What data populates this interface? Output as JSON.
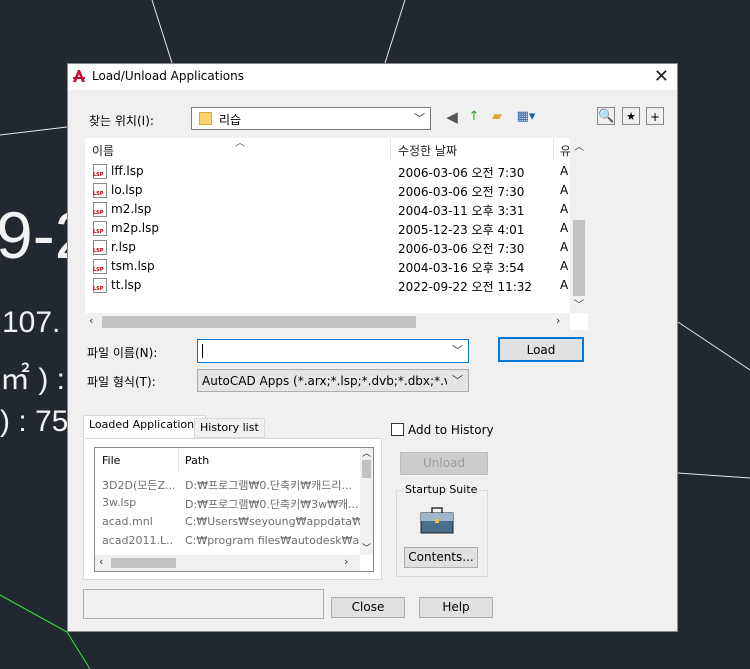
{
  "background": {
    "text1": "9-2",
    "text2": "107.",
    "text3": "㎡ )  :",
    "text4": ") : 75"
  },
  "dialog": {
    "title": "Load/Unload Applications",
    "look_in_label": "찾는 위치(I):",
    "look_in_value": "리습",
    "columns": {
      "name": "이름",
      "date": "수정한 날짜",
      "type": "유"
    },
    "files": [
      {
        "name": "lff.lsp",
        "date": "2006-03-06 오전 7:30",
        "type": "A"
      },
      {
        "name": "lo.lsp",
        "date": "2006-03-06 오전 7:30",
        "type": "A"
      },
      {
        "name": "m2.lsp",
        "date": "2004-03-11 오후 3:31",
        "type": "A"
      },
      {
        "name": "m2p.lsp",
        "date": "2005-12-23 오후 4:01",
        "type": "A"
      },
      {
        "name": "r.lsp",
        "date": "2006-03-06 오전 7:30",
        "type": "A"
      },
      {
        "name": "tsm.lsp",
        "date": "2004-03-16 오후 3:54",
        "type": "A"
      },
      {
        "name": "tt.lsp",
        "date": "2022-09-22 오전 11:32",
        "type": "A"
      }
    ],
    "file_name_label": "파일 이름(N):",
    "file_name_value": "",
    "file_type_label": "파일 형식(T):",
    "file_type_value": "AutoCAD Apps (*.arx;*.lsp;*.dvb;*.dbx;*.vlx;*.fa",
    "load_button": "Load",
    "tabs": [
      "Loaded Applications",
      "History list"
    ],
    "applist_columns": {
      "file": "File",
      "path": "Path"
    },
    "loaded_apps": [
      {
        "file": "3D2D(모든Z...",
        "path": "D:₩프로그램₩0.단축키₩캐드리..."
      },
      {
        "file": "3w.lsp",
        "path": "D:₩프로그램₩0.단축키₩3w₩캐..."
      },
      {
        "file": "acad.mnl",
        "path": "C:₩Users₩seyoung₩appdata₩ro..."
      },
      {
        "file": "acad2011.L...",
        "path": "C:₩program files₩autodesk₩auto..."
      }
    ],
    "add_to_history_label": "Add to History",
    "unload_button": "Unload",
    "startup_suite_label": "Startup Suite",
    "contents_button": "Contents...",
    "close_button": "Close",
    "help_button": "Help",
    "status_text": ""
  }
}
